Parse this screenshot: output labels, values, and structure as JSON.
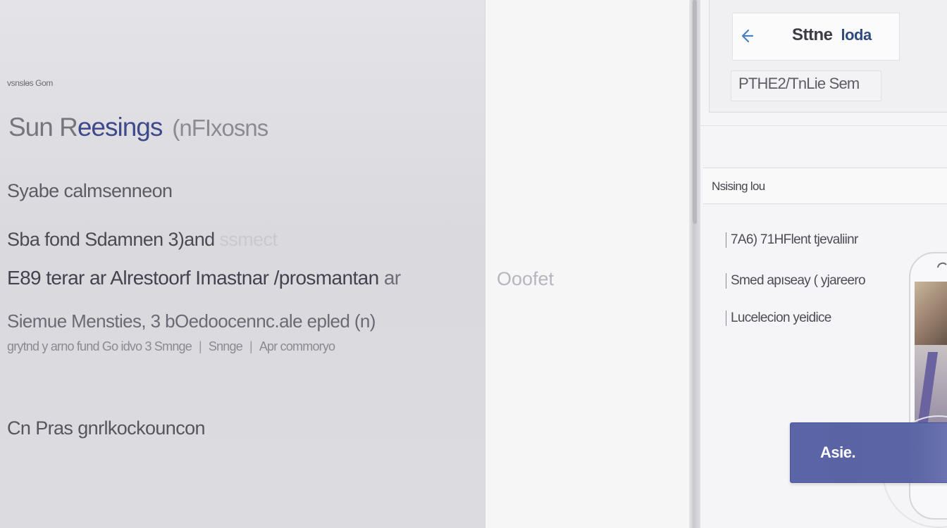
{
  "left": {
    "kicker": "vsnslɵs Gom",
    "title_part1": "Sun R",
    "title_accent": "eesings",
    "title_muted": "(nFIxosns",
    "line1": "Syabe calmsenneon",
    "line2_main": "Sba  fond Sdamnen 3)and",
    "line2_fade": " ssmect",
    "line3_main": "E89 terar ar Alrestoorf Imastnar /prosmantan",
    "line3_fade": " ar",
    "line4": "Siemue Mensties, 3 bOedoocennc.ale epled (n)",
    "line5_a": "grytnd y arno fund Go idvo 3 Smnge",
    "line5_b": "Snnge",
    "line5_c": "Apr commoryo",
    "line5_sep": "|",
    "line6": "Cn Pras gnrlkockouncon"
  },
  "middle": {
    "ghost": "Ooofet"
  },
  "right": {
    "title": "Sttne",
    "title_sub": "loda",
    "pill": "PTHE2/TnLie Sem",
    "section_label": "Nsising lou",
    "options": [
      "7A6) 71HFlent tjevaliinr",
      "Smed apıseay ( yjareero",
      "Lucelecion yeidice"
    ],
    "cta": "Asie."
  },
  "icons": {
    "back": "arrow-left-icon",
    "speaker": "camera-icon"
  },
  "colors": {
    "accent": "#3f4a8a",
    "cta": "#5a64a6",
    "back_icon": "#4a7fc0"
  }
}
